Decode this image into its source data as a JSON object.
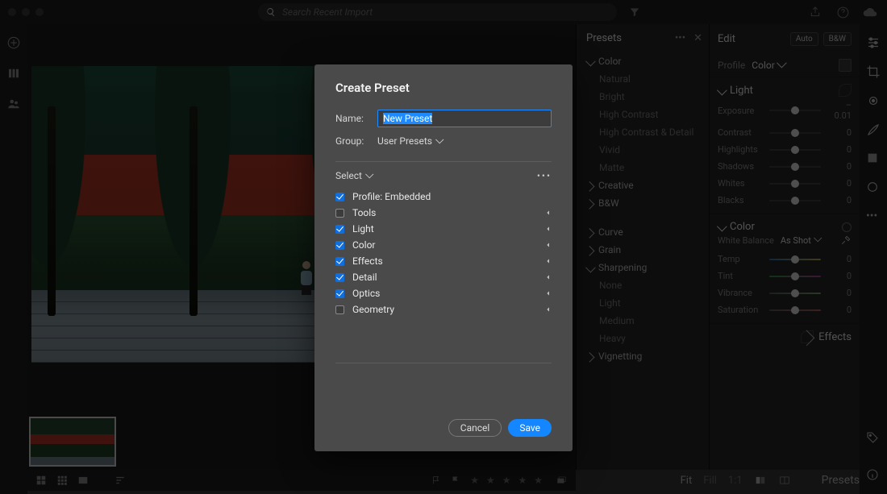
{
  "topbar": {
    "search_placeholder": "Search Recent Import"
  },
  "presets_panel": {
    "title": "Presets",
    "groups": [
      {
        "label": "Color",
        "expanded": true,
        "items": [
          "Natural",
          "Bright",
          "High Contrast",
          "High Contrast & Detail",
          "Vivid",
          "Matte"
        ]
      },
      {
        "label": "Creative",
        "expanded": false
      },
      {
        "label": "B&W",
        "expanded": false
      }
    ],
    "groups2": [
      {
        "label": "Curve",
        "expanded": false
      },
      {
        "label": "Grain",
        "expanded": false
      },
      {
        "label": "Sharpening",
        "expanded": true,
        "items": [
          "None",
          "Light",
          "Medium",
          "Heavy"
        ]
      },
      {
        "label": "Vignetting",
        "expanded": false
      }
    ]
  },
  "edit_panel": {
    "title": "Edit",
    "auto": "Auto",
    "bw": "B&W",
    "profile_label": "Profile",
    "profile_value": "Color",
    "light": {
      "title": "Light",
      "sliders": [
        {
          "label": "Exposure",
          "value": "– 0.01"
        },
        {
          "label": "Contrast",
          "value": "0"
        },
        {
          "label": "Highlights",
          "value": "0"
        },
        {
          "label": "Shadows",
          "value": "0"
        },
        {
          "label": "Whites",
          "value": "0"
        },
        {
          "label": "Blacks",
          "value": "0"
        }
      ]
    },
    "color": {
      "title": "Color",
      "wb_label": "White Balance",
      "wb_value": "As Shot",
      "sliders": [
        {
          "label": "Temp",
          "value": "0",
          "track": "temp"
        },
        {
          "label": "Tint",
          "value": "0",
          "track": "tint"
        },
        {
          "label": "Vibrance",
          "value": "0",
          "track": "vib"
        },
        {
          "label": "Saturation",
          "value": "0",
          "track": "sat"
        }
      ]
    },
    "effects": {
      "title": "Effects"
    }
  },
  "bottombar": {
    "fit": "Fit",
    "fill": "Fill",
    "oneone": "1:1",
    "presets": "Presets"
  },
  "dialog": {
    "title": "Create Preset",
    "name_label": "Name:",
    "name_value": "New Preset",
    "group_label": "Group:",
    "group_value": "User Presets",
    "select_label": "Select",
    "items": [
      {
        "label": "Profile: Embedded",
        "checked": true,
        "expandable": false
      },
      {
        "label": "Tools",
        "checked": false,
        "expandable": true
      },
      {
        "label": "Light",
        "checked": true,
        "expandable": true
      },
      {
        "label": "Color",
        "checked": true,
        "expandable": true
      },
      {
        "label": "Effects",
        "checked": true,
        "expandable": true
      },
      {
        "label": "Detail",
        "checked": true,
        "expandable": true
      },
      {
        "label": "Optics",
        "checked": true,
        "expandable": true
      },
      {
        "label": "Geometry",
        "checked": false,
        "expandable": true
      }
    ],
    "cancel": "Cancel",
    "save": "Save"
  }
}
